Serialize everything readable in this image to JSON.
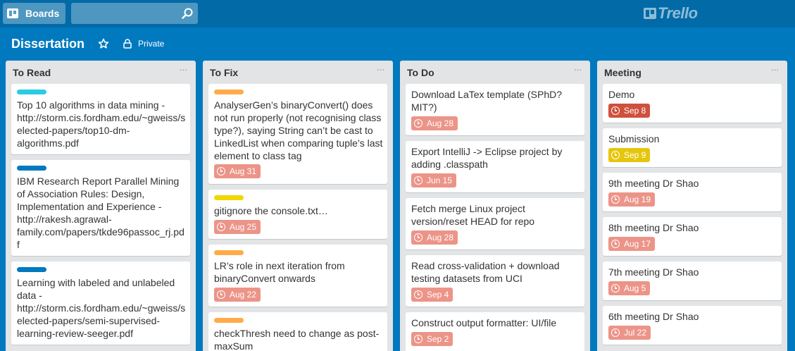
{
  "app": {
    "boards_label": "Boards",
    "search_placeholder": "",
    "logo_text": "Trello"
  },
  "board": {
    "title": "Dissertation",
    "privacy": "Private"
  },
  "colors": {
    "red_badge": "#ec9488",
    "overdue_badge": "#cf513d",
    "due_soon_badge": "#e6c60d",
    "label_cyan": "#29cce5",
    "label_blue": "#0079bf",
    "label_orange": "#ffab4a",
    "label_yellow": "#f2d600"
  },
  "lists": [
    {
      "title": "To Read",
      "cards": [
        {
          "label": "cyan",
          "text": "Top 10 algorithms in data mining - http://storm.cis.fordham.edu/~gweiss/selected-papers/top10-dm-algorithms.pdf"
        },
        {
          "label": "blue",
          "text": "IBM Research Report Parallel Mining of Association Rules: Design, Implementation and Experience - http://rakesh.agrawal-family.com/papers/tkde96passoc_rj.pdf"
        },
        {
          "label": "blue",
          "text": "Learning with labeled and unlabeled data - http://storm.cis.fordham.edu/~gweiss/selected-papers/semi-supervised-learning-review-seeger.pdf"
        }
      ]
    },
    {
      "title": "To Fix",
      "cards": [
        {
          "label": "orange",
          "text": "AnalyserGen’s binaryConvert() does not run properly (not recognising class type?), saying String can’t be cast to LinkedList when comparing tuple’s last element to class tag",
          "due": "Aug 31"
        },
        {
          "label": "yellow",
          "text": "gitignore the console.txt…",
          "due": "Aug 25"
        },
        {
          "label": "orange",
          "text": "LR’s role in next iteration from binaryConvert onwards",
          "due": "Aug 22"
        },
        {
          "label": "orange",
          "text": "checkThresh need to change as post-maxSum"
        }
      ]
    },
    {
      "title": "To Do",
      "cards": [
        {
          "text": "Download LaTex template (SPhD? MIT?)",
          "due": "Aug 28"
        },
        {
          "text": "Export IntelliJ -> Eclipse project by adding .classpath",
          "due": "Jun 15"
        },
        {
          "text": "Fetch merge Linux project version/reset HEAD for repo",
          "due": "Aug 28"
        },
        {
          "text": "Read cross-validation + download testing datasets from UCI",
          "due": "Sep 4"
        },
        {
          "text": "Construct output formatter: UI/file",
          "due": "Sep 2"
        }
      ]
    },
    {
      "title": "Meeting",
      "cards": [
        {
          "text": "Demo",
          "due": "Sep 8"
        },
        {
          "text": "Submission",
          "due": "Sep 9"
        },
        {
          "text": "9th meeting Dr Shao",
          "due": "Aug 19"
        },
        {
          "text": "8th meeting Dr Shao",
          "due": "Aug 17"
        },
        {
          "text": "7th meeting Dr Shao",
          "due": "Aug 5"
        },
        {
          "text": "6th meeting Dr Shao",
          "due": "Jul 22"
        }
      ]
    }
  ]
}
